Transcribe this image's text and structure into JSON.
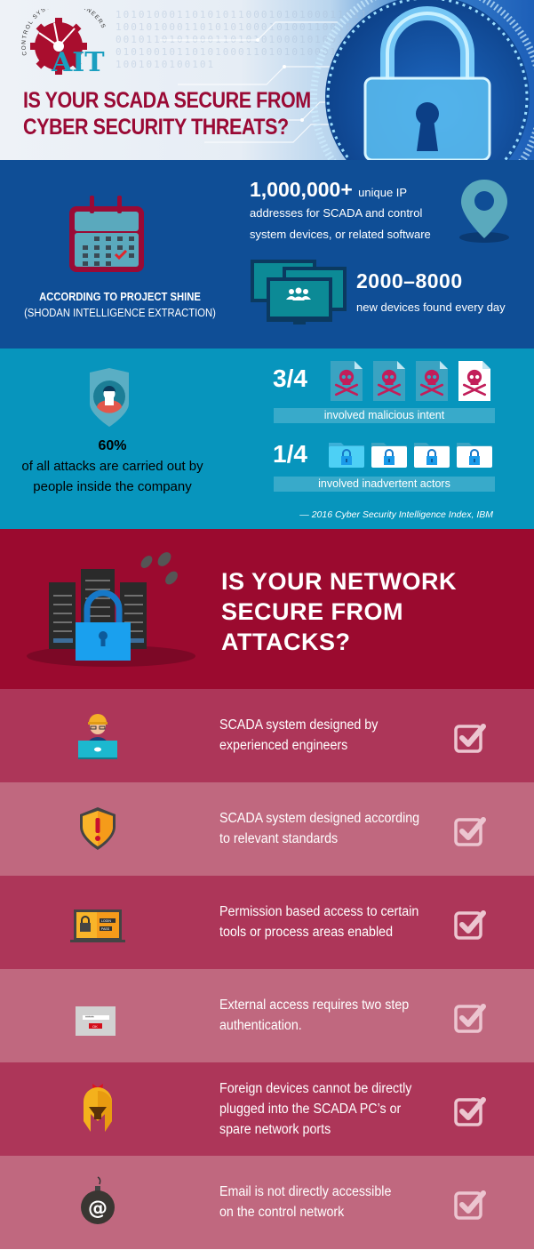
{
  "header": {
    "logo_text": "AIT",
    "logo_ring_text": "CONTROL SYSTEMS ENGINEERS",
    "title_line1": "IS YOUR SCADA SECURE FROM",
    "title_line2": "CYBER SECURITY THREATS?",
    "binary_pattern": "10101000110101011000101010001101101001010001101010100010100110010101001011010100011010101000101001100101010010110101000110101010001010011001010100101"
  },
  "project_shine": {
    "source_line1": "ACCORDING TO PROJECT SHINE",
    "source_line2": "(SHODAN INTELLIGENCE EXTRACTION)",
    "stat1_value": "1,000,000+",
    "stat1_suffix": "unique IP",
    "stat1_line2": "addresses for SCADA and control",
    "stat1_line3": "system devices, or related software",
    "stat2_value": "2000–8000",
    "stat2_label": "new devices found every day"
  },
  "insider": {
    "percent": "60%",
    "line1": "of all attacks are carried out by",
    "line2": "people inside the company",
    "malicious_fraction": "3/4",
    "malicious_label": "involved malicious intent",
    "malicious_share": 0.75,
    "inadvertent_fraction": "1/4",
    "inadvertent_label": "involved inadvertent actors",
    "inadvertent_share": 0.25,
    "source": "— 2016 Cyber Security Intelligence Index, IBM"
  },
  "network": {
    "title_line1": "IS YOUR NETWORK",
    "title_line2": "SECURE FROM",
    "title_line3": "ATTACKS?"
  },
  "checklist": [
    {
      "icon": "engineer-icon",
      "lines": [
        "SCADA system designed by",
        "experienced engineers"
      ],
      "checked": true
    },
    {
      "icon": "warning-shield-icon",
      "lines": [
        "SCADA system designed according",
        "to relevant standards"
      ],
      "checked": true
    },
    {
      "icon": "login-laptop-icon",
      "lines": [
        "Permission based access to certain",
        "tools or process areas enabled"
      ],
      "checked": true
    },
    {
      "icon": "password-dialog-icon",
      "lines": [
        "External access requires two step",
        "authentication."
      ],
      "checked": true
    },
    {
      "icon": "spartan-helmet-icon",
      "lines": [
        "Foreign devices cannot be directly",
        "plugged into the SCADA PC’s or",
        "spare network ports"
      ],
      "checked": true
    },
    {
      "icon": "email-bomb-icon",
      "lines": [
        "Email is not directly accessible",
        "on the control network"
      ],
      "checked": true
    }
  ],
  "password_dialog": {
    "mask": "*****",
    "ok": "OK"
  },
  "login_screen": {
    "login": "LOGIN",
    "pass": "PASS"
  },
  "colors": {
    "brand_red": "#9b0a2f",
    "title_red": "#9a0a35",
    "blue": "#0f4e96",
    "teal": "#0795bd",
    "row_dark": "#ad3659",
    "row_light": "#c0687f",
    "logo_teal": "#1a9fc0"
  }
}
